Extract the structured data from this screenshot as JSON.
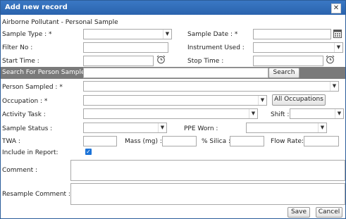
{
  "window": {
    "title": "Add new record",
    "close_symbol": "✕"
  },
  "subtitle": "Airborne Pollutant - Personal Sample",
  "fields": {
    "sample_type": {
      "label": "Sample Type : *",
      "value": ""
    },
    "sample_date": {
      "label": "Sample Date : *",
      "value": ""
    },
    "filter_no": {
      "label": "Filter No :",
      "value": ""
    },
    "instrument_used": {
      "label": "Instrument Used :",
      "value": ""
    },
    "start_time": {
      "label": "Start Time :",
      "value": ""
    },
    "stop_time": {
      "label": "Stop Time :",
      "value": ""
    },
    "search_person": {
      "label": "Search For Person Sampled :",
      "value": "",
      "button": "Search"
    },
    "person_sampled": {
      "label": "Person Sampled : *",
      "value": ""
    },
    "occupation": {
      "label": "Occupation : *",
      "value": "",
      "button": "All Occupations"
    },
    "activity_task": {
      "label": "Activity Task :",
      "value": ""
    },
    "shift": {
      "label": "Shift :",
      "value": ""
    },
    "sample_status": {
      "label": "Sample Status :",
      "value": ""
    },
    "ppe_worn": {
      "label": "PPE Worn :",
      "value": ""
    },
    "twa": {
      "label": "TWA :",
      "value": ""
    },
    "mass": {
      "label": "Mass (mg) :",
      "value": ""
    },
    "silica": {
      "label": "% Silica :",
      "value": ""
    },
    "flow_rate": {
      "label": "Flow Rate:",
      "value": ""
    },
    "include_in_report": {
      "label": "Include in Report:",
      "checked": true
    },
    "comment": {
      "label": "Comment :",
      "value": ""
    },
    "resample_comment": {
      "label": "Resample Comment :",
      "value": ""
    }
  },
  "footer": {
    "save": "Save",
    "cancel": "Cancel"
  },
  "colors": {
    "titlebar": "#2a63ad",
    "search_bar": "#7a7a7a",
    "checkbox": "#1b73d8"
  }
}
